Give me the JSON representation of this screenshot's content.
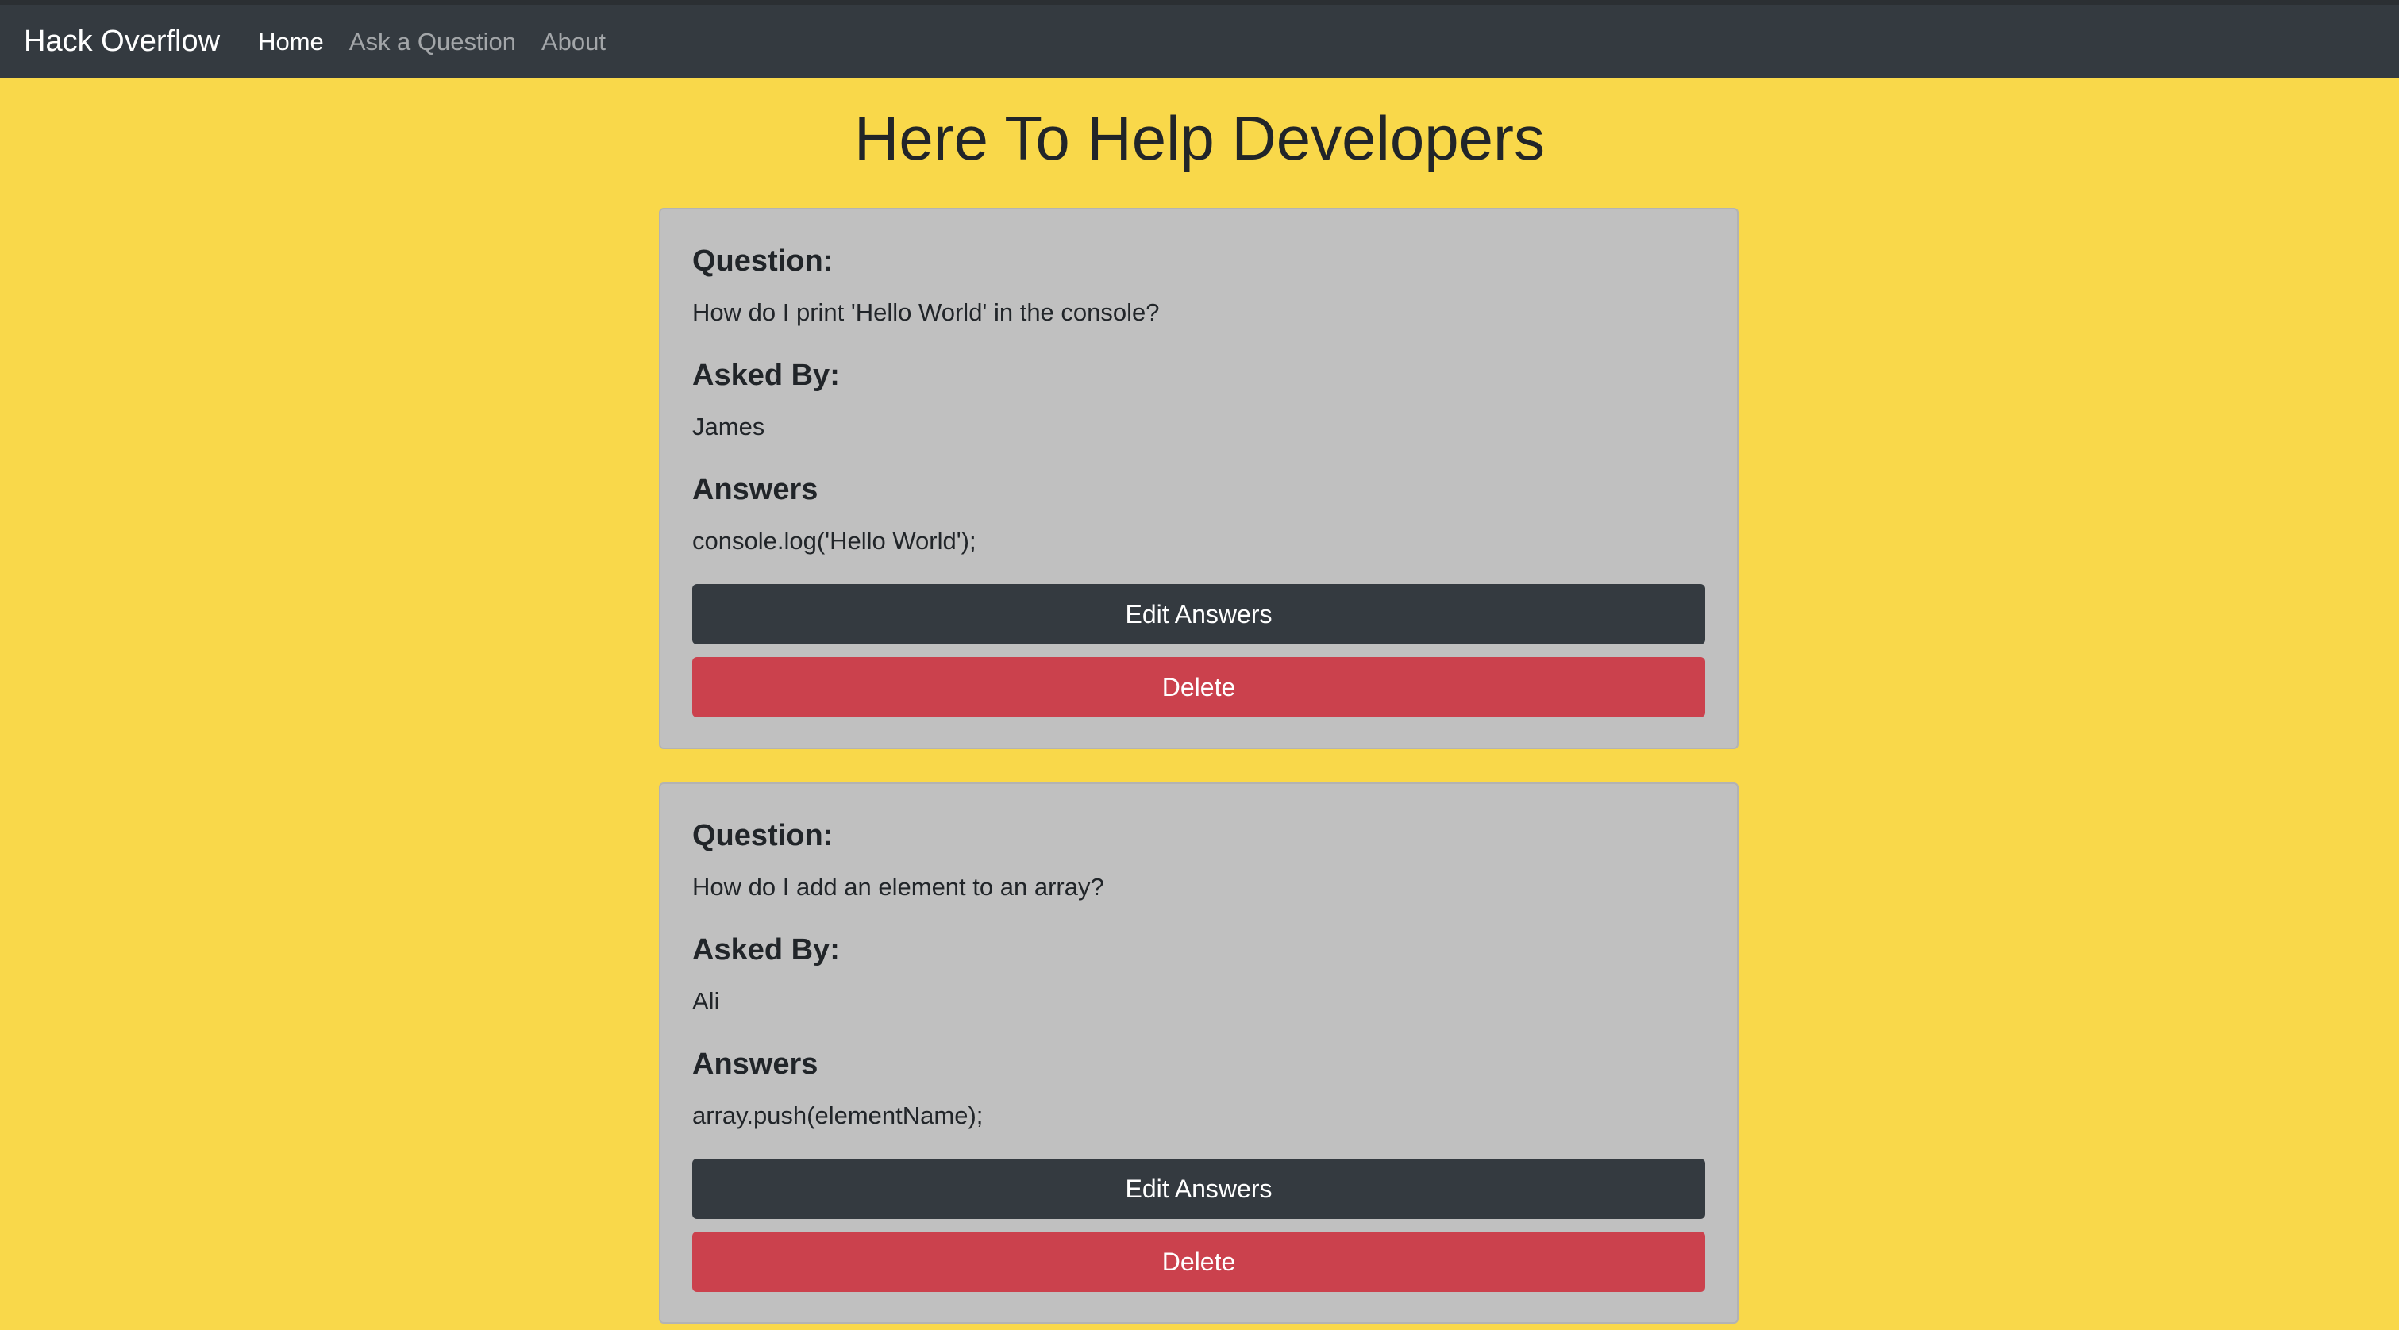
{
  "navbar": {
    "brand": "Hack Overflow",
    "links": [
      {
        "label": "Home"
      },
      {
        "label": "Ask a Question"
      },
      {
        "label": "About"
      }
    ]
  },
  "page": {
    "title": "Here To Help Developers"
  },
  "cards": [
    {
      "question_label": "Question:",
      "question": "How do I print 'Hello World' in the console?",
      "asked_by_label": "Asked By:",
      "asked_by": "James",
      "answers_label": "Answers",
      "answer": "console.log('Hello World');",
      "edit_label": "Edit Answers",
      "delete_label": "Delete"
    },
    {
      "question_label": "Question:",
      "question": "How do I add an element to an array?",
      "asked_by_label": "Asked By:",
      "asked_by": "Ali",
      "answers_label": "Answers",
      "answer": "array.push(elementName);",
      "edit_label": "Edit Answers",
      "delete_label": "Delete"
    }
  ],
  "colors": {
    "background": "#f9d84a",
    "navbar": "#343a40",
    "card": "#c0c0c0",
    "edit_button": "#343a40",
    "delete_button": "#cb414d"
  }
}
